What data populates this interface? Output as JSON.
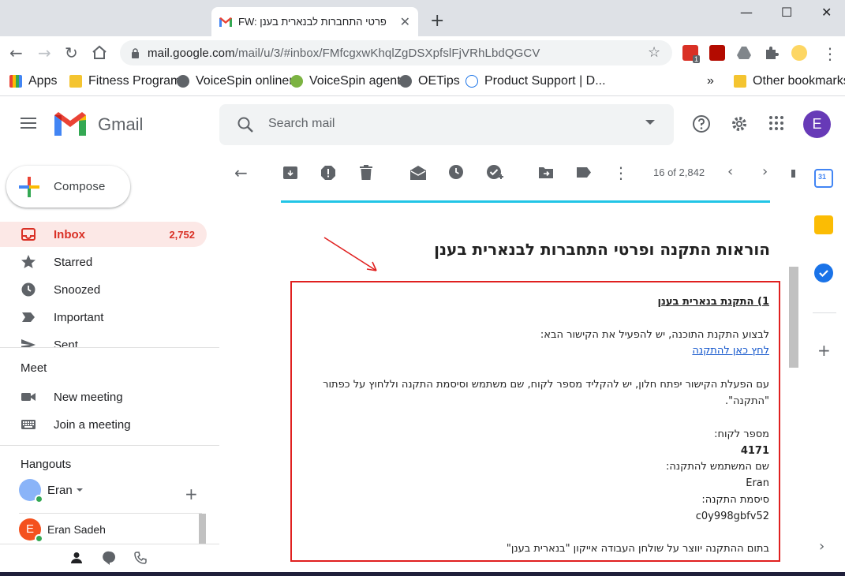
{
  "browser": {
    "tab_title": "FW: פרטי התחברות לבנארית בענן",
    "url_host": "mail.google.com",
    "url_path": "/mail/u/3/#inbox/FMfcgxwKhqlZgDSXpfslFjVRhLbdQGCV",
    "bookmarks": [
      {
        "label": "Apps",
        "color": "#ea4335"
      },
      {
        "label": "Fitness Program",
        "color": "#f4c430"
      },
      {
        "label": "VoiceSpin onliner",
        "color": "#5f6368"
      },
      {
        "label": "VoiceSpin agent",
        "color": "#7cb342"
      },
      {
        "label": "OETips",
        "color": "#5f6368"
      },
      {
        "label": "Product Support | D...",
        "color": "#1a73e8"
      }
    ],
    "bookmarks_overflow": "»",
    "other_bookmarks": "Other bookmarks",
    "ext_badge": "1"
  },
  "gmail": {
    "brand": "Gmail",
    "search_placeholder": "Search mail",
    "avatar_letter": "E",
    "compose_label": "Compose",
    "nav": [
      {
        "label": "Inbox",
        "count": "2,752",
        "icon": "inbox-icon"
      },
      {
        "label": "Starred",
        "count": "",
        "icon": "star-icon"
      },
      {
        "label": "Snoozed",
        "count": "",
        "icon": "clock-icon"
      },
      {
        "label": "Important",
        "count": "",
        "icon": "important-icon"
      },
      {
        "label": "Sent",
        "count": "",
        "icon": "send-icon"
      }
    ],
    "meet": {
      "title": "Meet",
      "new_meeting": "New meeting",
      "join_meeting": "Join a meeting"
    },
    "hangouts": {
      "title": "Hangouts",
      "user": "Eran",
      "contact": "Eran Sadeh",
      "contact_initial": "E"
    },
    "pager": "16 of 2,842"
  },
  "message": {
    "heading": "הוראות התקנה ופרטי התחברות לבנארית בענן",
    "section_title": "1) התקנת בנארית בענן",
    "instruction": "לבצוע התקנת התוכנה, יש להפעיל את הקישור הבא:",
    "link_text": "לחץ כאן להתקנה",
    "para1_line1": "עם הפעלת הקישור יפתח חלון, יש להקליד מספר לקוח, שם משתמש וסיסמת התקנה וללחוץ על כפתור",
    "para1_line2": "\"התקנה\".",
    "customer_label": "מספר לקוח:",
    "customer_value": "4171",
    "user_label": "שם המשתמש להתקנה:",
    "user_value": "Eran",
    "password_label": "סיסמת התקנה:",
    "password_value": "c0y998gbfv52",
    "final_line": "בתום ההתקנה יווצר על שולחן העבודה אייקון \"בנארית בענן\""
  },
  "colors": {
    "accent_red": "#d93025",
    "highlight_box": "#e0201f",
    "cyan_rule": "#22c5e6",
    "avatar": "#673ab7"
  }
}
